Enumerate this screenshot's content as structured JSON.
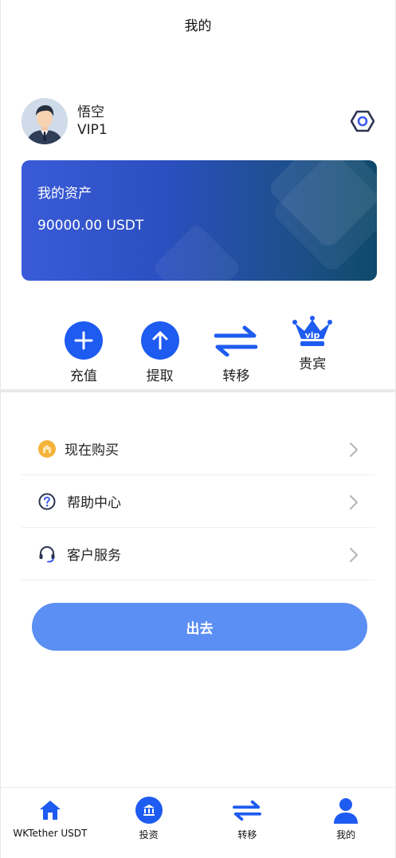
{
  "header": {
    "title": "我的"
  },
  "profile": {
    "name": "悟空",
    "level": "VIP1"
  },
  "asset_card": {
    "title": "我的资产",
    "amount": "90000.00 USDT"
  },
  "actions": [
    {
      "label": "充值",
      "icon": "plus-circle-icon"
    },
    {
      "label": "提取",
      "icon": "arrow-up-circle-icon"
    },
    {
      "label": "转移",
      "icon": "transfer-arrows-icon"
    },
    {
      "label": "贵宾",
      "icon": "vip-crown-icon"
    }
  ],
  "menu": [
    {
      "label": "现在购买",
      "icon": "shop-icon"
    },
    {
      "label": "帮助中心",
      "icon": "help-icon"
    },
    {
      "label": "客户服务",
      "icon": "headset-icon"
    }
  ],
  "logout": {
    "label": "出去"
  },
  "tabbar": [
    {
      "label": "WKTether USDT",
      "icon": "home-icon"
    },
    {
      "label": "投资",
      "icon": "bank-icon"
    },
    {
      "label": "转移",
      "icon": "transfer-icon"
    },
    {
      "label": "我的",
      "icon": "user-icon"
    }
  ],
  "colors": {
    "primary": "#1e5bf0",
    "logout": "#5b8ff3",
    "card_start": "#3a5bd8",
    "card_end": "#0f4a6a",
    "shop_icon": "#f5b33b"
  }
}
